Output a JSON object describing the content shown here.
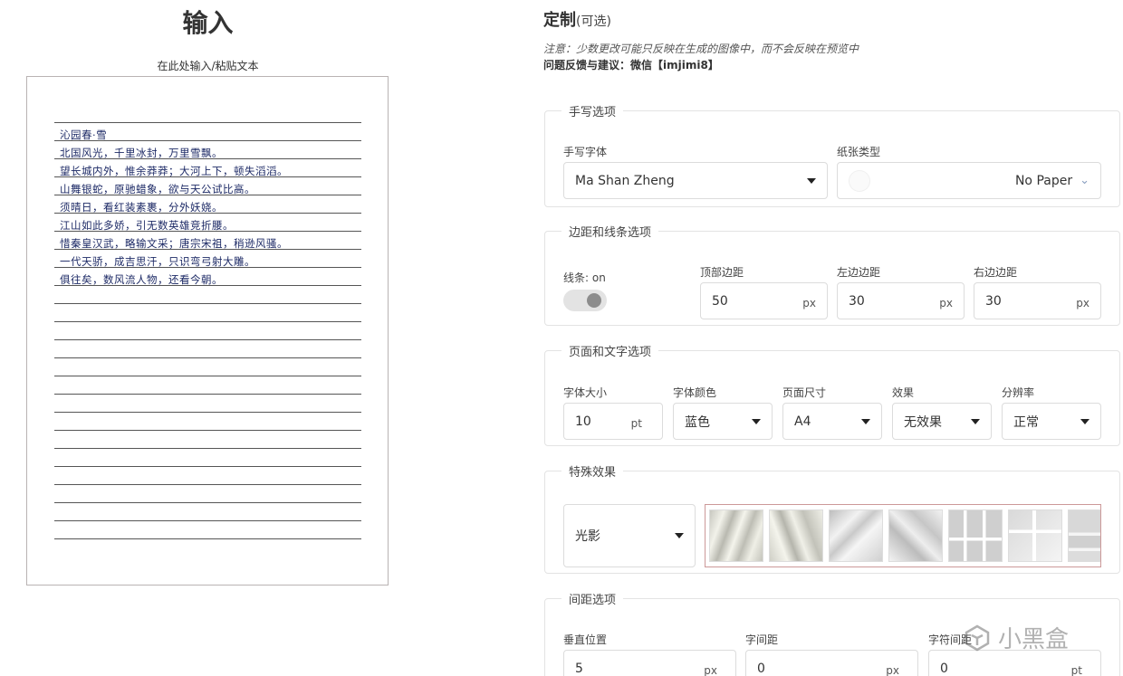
{
  "left": {
    "title": "输入",
    "caption": "在此处输入/粘贴文本",
    "poem_lines": [
      "沁园春·雪",
      "北国风光，千里冰封，万里雪飘。",
      "望长城内外，惟余莽莽；大河上下，顿失滔滔。",
      "山舞银蛇，原驰蜡象，欲与天公试比高。",
      "须晴日，看红装素裹，分外妖娆。",
      "江山如此多娇，引无数英雄竞折腰。",
      "惜秦皇汉武，略输文采；唐宗宋祖，稍逊风骚。",
      "一代天骄，成吉思汗，只识弯弓射大雕。",
      "俱往矣，数风流人物，还看今朝。"
    ]
  },
  "right": {
    "title": "定制",
    "title_sub": "(可选)",
    "note": "注意：少数更改可能只反映在生成的图像中，而不会反映在预览中",
    "feedback": "问题反馈与建议：微信【imjimi8】",
    "handwriting": {
      "legend": "手写选项",
      "font_label": "手写字体",
      "font_value": "Ma Shan Zheng",
      "paper_label": "纸张类型",
      "paper_value": "No Paper"
    },
    "margins": {
      "legend": "边距和线条选项",
      "lines_label": "线条: on",
      "top_label": "顶部边距",
      "top_value": "50",
      "left_label": "左边边距",
      "left_value": "30",
      "right_label": "右边边距",
      "right_value": "30",
      "unit": "px"
    },
    "page": {
      "legend": "页面和文字选项",
      "size_label": "字体大小",
      "size_value": "10",
      "size_unit": "pt",
      "color_label": "字体颜色",
      "color_value": "蓝色",
      "page_label": "页面尺寸",
      "page_value": "A4",
      "effect_label": "效果",
      "effect_value": "无效果",
      "res_label": "分辨率",
      "res_value": "正常"
    },
    "special": {
      "legend": "特殊效果",
      "select_value": "光影"
    },
    "spacing": {
      "legend": "间距选项",
      "vertical_label": "垂直位置",
      "vertical_value": "5",
      "vertical_unit": "px",
      "char_label": "字间距",
      "char_value": "0",
      "char_unit": "px",
      "glyph_label": "字符间距",
      "glyph_value": "0",
      "glyph_unit": "pt"
    }
  },
  "watermark": {
    "text": "小黑盒"
  },
  "colors": {
    "ink": "#1d2a66",
    "border": "#dcdcdc",
    "toggle_knob": "#8c8c8c"
  }
}
